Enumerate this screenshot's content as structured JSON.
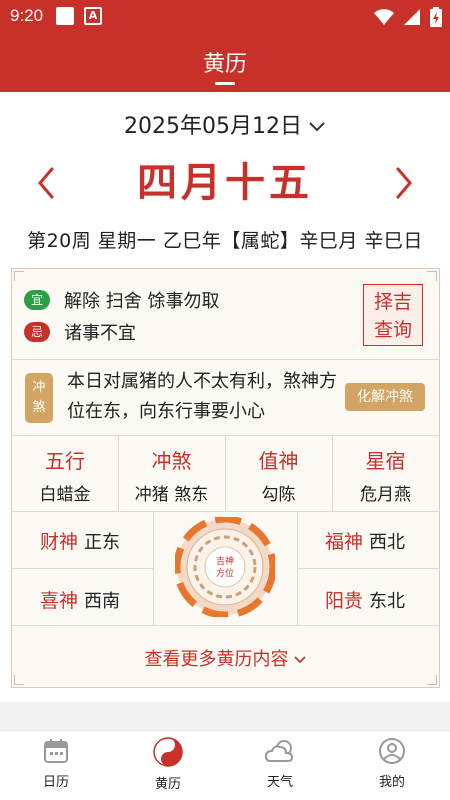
{
  "status": {
    "time": "9:20",
    "notification_icon_letter": "A",
    "icons": [
      "app-notification-icon",
      "a-notification-icon",
      "wifi-icon",
      "signal-icon",
      "battery-icon"
    ]
  },
  "app_bar": {
    "title": "黄历"
  },
  "date": {
    "solar": "2025年05月12日"
  },
  "lunar": {
    "date": "四月十五"
  },
  "info_line": "第20周 星期一 乙巳年【属蛇】辛巳月 辛巳日",
  "yi_ji": {
    "yi_badge": "宜",
    "yi_text": "解除 扫舍 馀事勿取",
    "ji_badge": "忌",
    "ji_text": "诸事不宜",
    "zeji_line1": "择吉",
    "zeji_line2": "查询"
  },
  "chong_sha": {
    "badge_line1": "冲",
    "badge_line2": "煞",
    "text": "本日对属猪的人不太有利，煞神方位在东，向东行事要小心",
    "resolve_button": "化解冲煞"
  },
  "stats": [
    {
      "label": "五行",
      "value": "白蜡金"
    },
    {
      "label": "冲煞",
      "value": "冲猪 煞东"
    },
    {
      "label": "值神",
      "value": "勾陈"
    },
    {
      "label": "星宿",
      "value": "危月燕"
    }
  ],
  "directions": {
    "caishen": {
      "label": "财神",
      "value": "正东"
    },
    "xishen": {
      "label": "喜神",
      "value": "西南"
    },
    "fushen": {
      "label": "福神",
      "value": "西北"
    },
    "yanggui": {
      "label": "阳贵",
      "value": "东北"
    },
    "compass_center_line1": "吉神",
    "compass_center_line2": "方位"
  },
  "more_link": "查看更多黄历内容",
  "bottom_nav": [
    {
      "label": "日历",
      "icon": "calendar-icon",
      "active": false
    },
    {
      "label": "黄历",
      "icon": "yin-yang-icon",
      "active": true
    },
    {
      "label": "天气",
      "icon": "cloud-icon",
      "active": false
    },
    {
      "label": "我的",
      "icon": "user-icon",
      "active": false
    }
  ],
  "colors": {
    "primary_red": "#c8302a",
    "yi_green": "#2a9f45",
    "gold": "#d3a564",
    "card_border": "#e4c7ba"
  }
}
